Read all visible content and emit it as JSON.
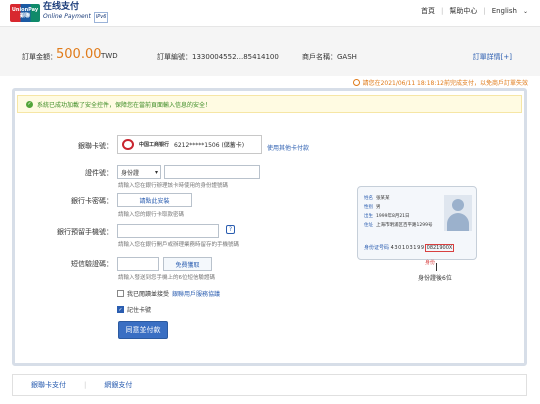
{
  "header": {
    "logo_badge_top": "UnionPay",
    "logo_badge_bottom": "銀聯",
    "logo_cn": "在线支付",
    "logo_en": "Online Payment",
    "logo_ipv6": "IPv6",
    "nav": [
      "首頁",
      "幫助中心",
      "English"
    ]
  },
  "order": {
    "amount_label": "訂單金額：",
    "amount_value": "500.00",
    "currency": "TWD",
    "order_no_label": "訂單編號：",
    "order_no": "1330004552...85414100",
    "merchant_label": "商戶名稱：",
    "merchant": "GASH",
    "detail_link": "訂單詳情[+]"
  },
  "warning": "請您在2021/06/11 18:18:12前完成支付，以免商戶訂單失效",
  "success_msg": "系統已成功加載了安全控件，保障您在當前頁面輸入信息的安全！",
  "form": {
    "card_label": "銀聯卡號：",
    "bank_name": "中国工商银行",
    "card_number": "6212*****1506 (儲蓄卡)",
    "other_card_link": "使用其他卡付款",
    "id_label": "證件號：",
    "id_type": "身份證",
    "id_hint": "請輸入您在銀行辦理該卡時使用的身份證號碼",
    "pwd_label": "銀行卡密碼：",
    "install_button": "請點此安裝",
    "pwd_hint": "請輸入您的銀行卡取款密碼",
    "phone_label": "銀行預留手機號：",
    "phone_help": "?",
    "phone_hint": "請輸入您在銀行開戶或辦理業務時留存的手機號碼",
    "sms_label": "短信驗證碼：",
    "sms_button": "免費獲取",
    "sms_hint": "請輸入發送到您手機上的6位短信驗證碼",
    "agree_text": "我已閱讀並接受",
    "agree_link": "銀聯用戶服務協議",
    "remember_text": "記住卡號",
    "pay_button": "同意並付款"
  },
  "idcard": {
    "name_label": "姓名",
    "name": "张某某",
    "sex_label": "性别",
    "sex": "男",
    "birth_label": "出生",
    "birth": "1999年8月21日",
    "address_label": "住址",
    "address": "上海市明浦区百平路1299号",
    "id_label": "身份证号码",
    "id_prefix": "430103199",
    "id_highlight": "0821900X",
    "last6_tag": "身份",
    "caption": "身份證後6位"
  },
  "bottom_tabs": [
    "銀聯卡支付",
    "網銀支付"
  ]
}
